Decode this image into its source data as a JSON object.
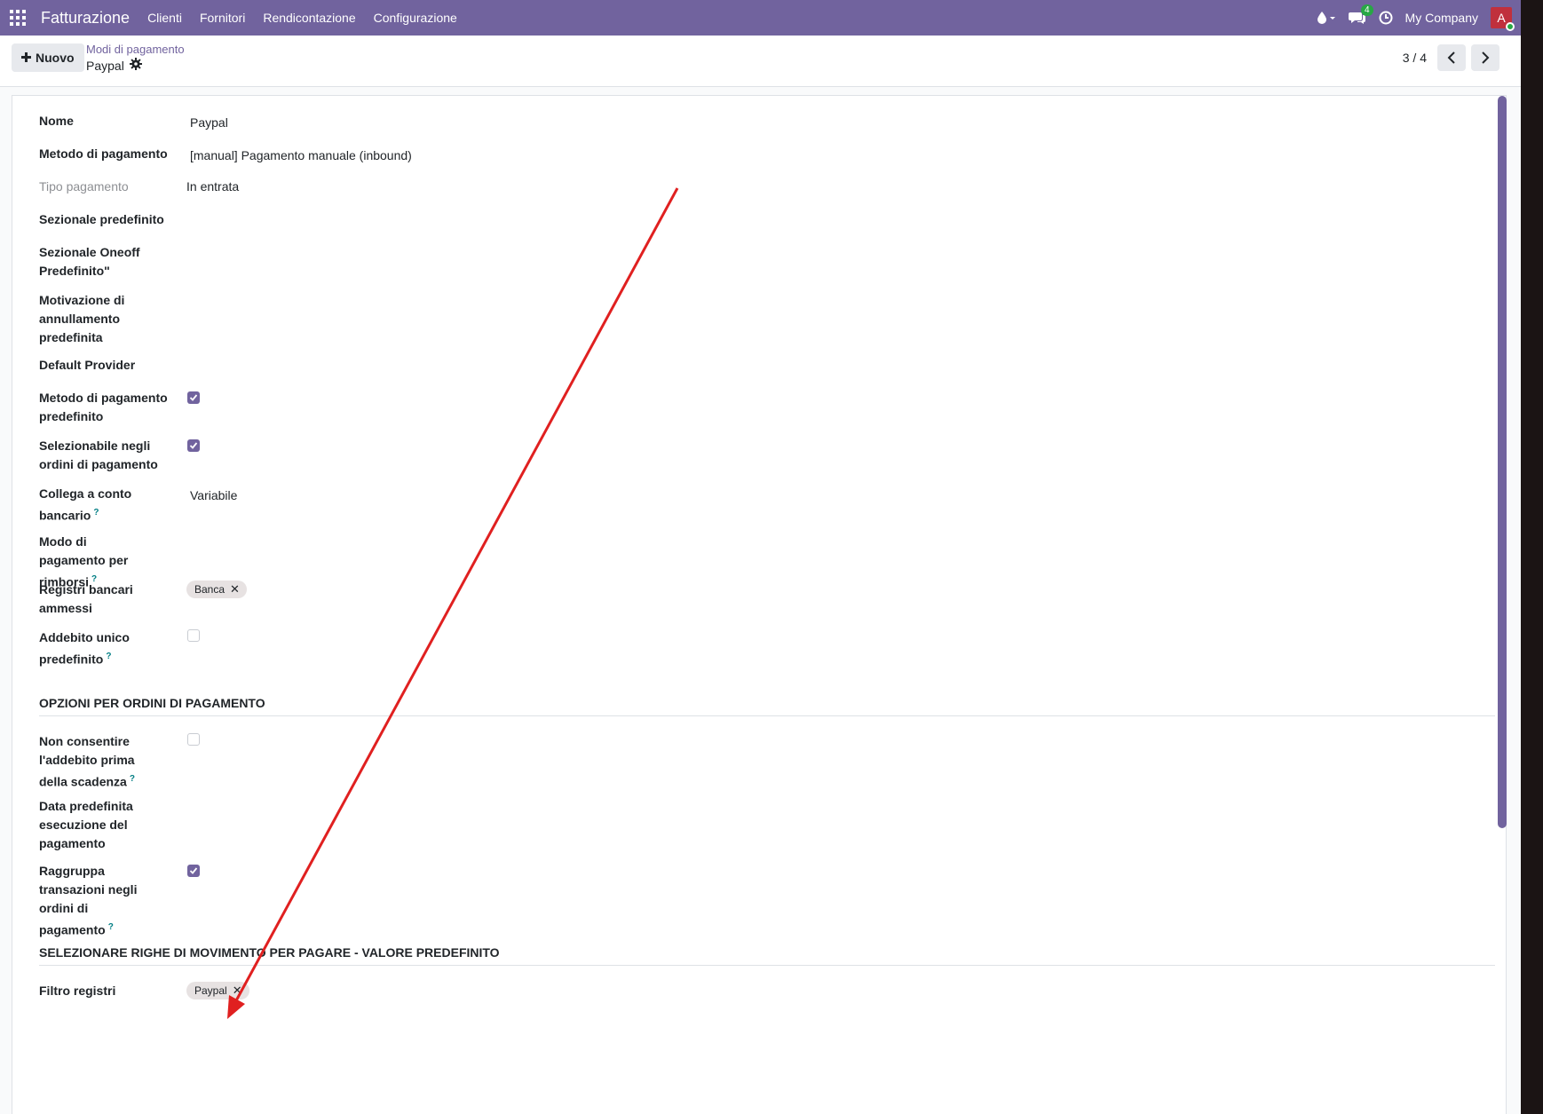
{
  "navbar": {
    "app_name": "Fatturazione",
    "menu": [
      "Clienti",
      "Fornitori",
      "Rendicontazione",
      "Configurazione"
    ],
    "messages_count": "4",
    "company": "My Company",
    "avatar_initial": "A"
  },
  "control": {
    "new_label": "Nuovo",
    "breadcrumb": "Modi di pagamento",
    "record_title": "Paypal",
    "pager": "3 / 4"
  },
  "form": {
    "nome": {
      "label": "Nome",
      "value": "Paypal"
    },
    "metodo": {
      "label": "Metodo di pagamento",
      "value": "[manual] Pagamento manuale (inbound)"
    },
    "tipo": {
      "label": "Tipo pagamento",
      "value": "In entrata"
    },
    "sezionale": {
      "label": "Sezionale predefinito"
    },
    "oneoff": {
      "label": "Sezionale Oneoff Predefinito\""
    },
    "motivazione": {
      "label": "Motivazione di annullamento predefinita"
    },
    "provider": {
      "label": "Default Provider"
    },
    "metodo_predef": {
      "label": "Metodo di pagamento predefinito",
      "checked": true
    },
    "selezionabile": {
      "label": "Selezionabile negli ordini di pagamento",
      "checked": true
    },
    "collega": {
      "label": "Collega a conto bancario",
      "help": "?",
      "value": "Variabile"
    },
    "rimborsi": {
      "label": "Modo di pagamento per rimborsi",
      "help": "?"
    },
    "registri": {
      "label": "Registri bancari ammessi",
      "tag": "Banca"
    },
    "addebito": {
      "label": "Addebito unico predefinito",
      "help": "?",
      "checked": false
    }
  },
  "section_orders": {
    "title": "OPZIONI PER ORDINI DI PAGAMENTO",
    "non_consentire": {
      "label": "Non consentire l'addebito prima della scadenza",
      "help": "?",
      "checked": false
    },
    "data_predef": {
      "label": "Data predefinita esecuzione del pagamento"
    },
    "raggruppa": {
      "label": "Raggruppa transazioni negli ordini di pagamento",
      "help": "?",
      "checked": true
    }
  },
  "section_lines": {
    "title": "SELEZIONARE RIGHE DI MOVIMENTO PER PAGARE - VALORE PREDEFINITO",
    "filtro": {
      "label": "Filtro registri",
      "tag": "Paypal"
    }
  },
  "colors": {
    "brand": "#71639e",
    "annotation_arrow": "#e02020"
  }
}
